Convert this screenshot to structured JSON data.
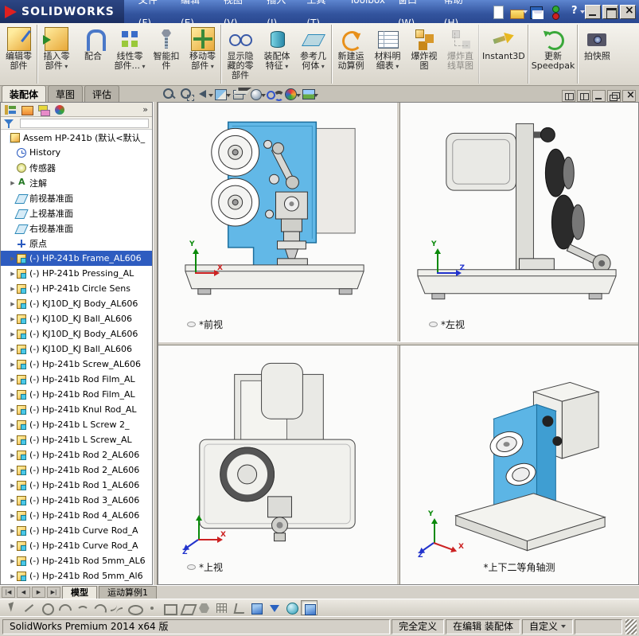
{
  "titlebar": {
    "logo_text": "SOLIDWORKS",
    "menus": [
      "文件(F)",
      "编辑(E)",
      "视图(V)",
      "插入(I)",
      "工具(T)",
      "Toolbox",
      "窗口(W)",
      "帮助(H)"
    ],
    "quick_icons": [
      {
        "name": "new-document-icon",
        "cls": "q-new",
        "dd": ""
      },
      {
        "name": "open-icon",
        "cls": "q-open",
        "dd": "has-dd"
      },
      {
        "name": "save-icon",
        "cls": "q-save",
        "dd": "has-dd"
      },
      {
        "name": "rebuild-icon",
        "cls": "q-rebuild",
        "dd": ""
      },
      {
        "name": "help-icon",
        "cls": "q-help",
        "dd": "has-dd"
      }
    ],
    "window_buttons": [
      "minimize",
      "maximize",
      "close"
    ]
  },
  "commandmanager": {
    "buttons": [
      {
        "label": "编辑零\n部件",
        "icon": "ic-editcomp",
        "name": "edit-component-button",
        "dd": "",
        "state": "",
        "grp": "grp-end"
      },
      {
        "label": "插入零\n部件",
        "icon": "ic-insertcomp",
        "name": "insert-components-button",
        "dd": "has-dd",
        "state": "",
        "grp": ""
      },
      {
        "label": "配合",
        "icon": "ic-mate",
        "name": "mate-button",
        "dd": "",
        "state": "",
        "grp": ""
      },
      {
        "label": "线性零\n部件...",
        "icon": "ic-pattern",
        "name": "linear-component-pattern-button",
        "dd": "has-dd",
        "state": "",
        "grp": ""
      },
      {
        "label": "智能扣\n件",
        "icon": "ic-fastener",
        "name": "smart-fasteners-button",
        "dd": "",
        "state": "",
        "grp": ""
      },
      {
        "label": "移动零\n部件",
        "icon": "ic-movecomp",
        "name": "move-component-button",
        "dd": "has-dd",
        "state": "",
        "grp": "grp-end"
      },
      {
        "label": "显示隐\n藏的零\n部件",
        "icon": "ic-showhidden",
        "name": "show-hidden-components-button",
        "dd": "",
        "state": "",
        "grp": ""
      },
      {
        "label": "装配体\n特征",
        "icon": "ic-asmfeat",
        "name": "assembly-features-button",
        "dd": "has-dd",
        "state": "",
        "grp": ""
      },
      {
        "label": "参考几\n何体",
        "icon": "ic-refgeo",
        "name": "reference-geometry-button",
        "dd": "has-dd",
        "state": "",
        "grp": "grp-end"
      },
      {
        "label": "新建运\n动算例",
        "icon": "ic-motion",
        "name": "new-motion-study-button",
        "dd": "",
        "state": "",
        "grp": ""
      },
      {
        "label": "材料明\n细表",
        "icon": "ic-bom",
        "name": "bill-of-materials-button",
        "dd": "has-dd",
        "state": "",
        "grp": ""
      },
      {
        "label": "爆炸视\n图",
        "icon": "ic-explode",
        "name": "exploded-view-button",
        "dd": "",
        "state": "",
        "grp": ""
      },
      {
        "label": "爆炸直\n线草图",
        "icon": "ic-explline",
        "name": "explode-line-sketch-button",
        "dd": "",
        "state": "disabled",
        "grp": "grp-end"
      },
      {
        "label": "Instant3D",
        "icon": "ic-instant3d",
        "name": "instant3d-button",
        "dd": "",
        "state": "",
        "grp": "grp-end"
      },
      {
        "label": "更新\nSpeedpak",
        "icon": "ic-speedpak",
        "name": "update-speedpak-button",
        "dd": "",
        "state": "",
        "grp": "grp-end"
      },
      {
        "label": "拍快照",
        "icon": "ic-snapshot",
        "name": "take-snapshot-button",
        "dd": "",
        "state": "",
        "grp": ""
      }
    ]
  },
  "ribbon_tabs": [
    {
      "label": "装配体",
      "cls": "active"
    },
    {
      "label": "草图",
      "cls": ""
    },
    {
      "label": "评估",
      "cls": ""
    }
  ],
  "view_toolbar": {
    "icons": [
      {
        "name": "zoom-fit-icon",
        "cls": "h-zoomfit",
        "dd": ""
      },
      {
        "name": "zoom-area-icon",
        "cls": "h-zoomarea",
        "dd": ""
      },
      {
        "name": "previous-view-icon",
        "cls": "h-prev",
        "dd": "has-dd"
      },
      {
        "name": "section-view-icon",
        "cls": "h-section",
        "dd": "has-dd"
      },
      {
        "name": "view-orientation-icon",
        "cls": "h-vieworient",
        "dd": "has-dd"
      },
      {
        "name": "display-style-icon",
        "cls": "h-display",
        "dd": "has-dd"
      },
      {
        "name": "hide-show-items-icon",
        "cls": "h-hideshow",
        "dd": "has-dd"
      },
      {
        "name": "edit-appearance-icon",
        "cls": "h-appearance",
        "dd": "has-dd"
      },
      {
        "name": "apply-scene-icon",
        "cls": "h-scene",
        "dd": "has-dd"
      }
    ],
    "window_icons": [
      "pane-layout",
      "pane-layout-2",
      "doc-minimize",
      "doc-restore",
      "doc-close"
    ]
  },
  "feature_tree": {
    "panel_tabs": [
      {
        "name": "featuremanager-tab-icon",
        "cls": "p-feat"
      },
      {
        "name": "propertymanager-tab-icon",
        "cls": "p-prop"
      },
      {
        "name": "configurationmanager-tab-icon",
        "cls": "p-config"
      },
      {
        "name": "displaymanager-tab-icon",
        "cls": "p-display"
      }
    ],
    "overflow": "»",
    "root": "Assem HP-241b (默认<默认_",
    "items": [
      {
        "t": "History",
        "icon": "i-history",
        "arrow": "",
        "cls": ""
      },
      {
        "t": "传感器",
        "icon": "i-sensor",
        "arrow": "",
        "cls": ""
      },
      {
        "t": "注解",
        "icon": "i-annot",
        "arrow": "▶",
        "cls": ""
      },
      {
        "t": "前视基准面",
        "icon": "i-plane",
        "arrow": "",
        "cls": ""
      },
      {
        "t": "上视基准面",
        "icon": "i-plane",
        "arrow": "",
        "cls": ""
      },
      {
        "t": "右视基准面",
        "icon": "i-plane",
        "arrow": "",
        "cls": ""
      },
      {
        "t": "原点",
        "icon": "i-origin",
        "arrow": "",
        "cls": ""
      },
      {
        "t": "(-) HP-241b Frame_AL606",
        "icon": "i-part",
        "arrow": "▶",
        "cls": "selected"
      },
      {
        "t": "(-) HP-241b Pressing_AL",
        "icon": "i-part",
        "arrow": "▶",
        "cls": ""
      },
      {
        "t": "(-) HP-241b Circle Sens",
        "icon": "i-part",
        "arrow": "▶",
        "cls": ""
      },
      {
        "t": "(-) KJ10D_KJ Body_AL606",
        "icon": "i-part",
        "arrow": "▶",
        "cls": ""
      },
      {
        "t": "(-) KJ10D_KJ Ball_AL606",
        "icon": "i-part",
        "arrow": "▶",
        "cls": ""
      },
      {
        "t": "(-) KJ10D_KJ Body_AL606",
        "icon": "i-part",
        "arrow": "▶",
        "cls": ""
      },
      {
        "t": "(-) KJ10D_KJ Ball_AL606",
        "icon": "i-part",
        "arrow": "▶",
        "cls": ""
      },
      {
        "t": "(-) Hp-241b Screw_AL606",
        "icon": "i-part",
        "arrow": "▶",
        "cls": ""
      },
      {
        "t": "(-) Hp-241b Rod Film_AL",
        "icon": "i-part",
        "arrow": "▶",
        "cls": ""
      },
      {
        "t": "(-) Hp-241b Rod Film_AL",
        "icon": "i-part",
        "arrow": "▶",
        "cls": ""
      },
      {
        "t": "(-) Hp-241b Knul Rod_AL",
        "icon": "i-part",
        "arrow": "▶",
        "cls": ""
      },
      {
        "t": "(-) Hp-241b L Screw 2_",
        "icon": "i-part",
        "arrow": "▶",
        "cls": ""
      },
      {
        "t": "(-) Hp-241b L Screw_AL",
        "icon": "i-part",
        "arrow": "▶",
        "cls": ""
      },
      {
        "t": "(-) Hp-241b Rod 2_AL606",
        "icon": "i-part",
        "arrow": "▶",
        "cls": ""
      },
      {
        "t": "(-) Hp-241b Rod 2_AL606",
        "icon": "i-part",
        "arrow": "▶",
        "cls": ""
      },
      {
        "t": "(-) Hp-241b Rod 1_AL606",
        "icon": "i-part",
        "arrow": "▶",
        "cls": ""
      },
      {
        "t": "(-) Hp-241b Rod 3_AL606",
        "icon": "i-part",
        "arrow": "▶",
        "cls": ""
      },
      {
        "t": "(-) Hp-241b Rod 4_AL606",
        "icon": "i-part",
        "arrow": "▶",
        "cls": ""
      },
      {
        "t": "(-) Hp-241b Curve Rod_A",
        "icon": "i-part",
        "arrow": "▶",
        "cls": ""
      },
      {
        "t": "(-) Hp-241b Curve Rod_A",
        "icon": "i-part",
        "arrow": "▶",
        "cls": ""
      },
      {
        "t": "(-) Hp-241b Rod 5mm_AL6",
        "icon": "i-part",
        "arrow": "▶",
        "cls": ""
      },
      {
        "t": "(-) Hp-241b Rod 5mm_Al6",
        "icon": "i-part",
        "arrow": "▶",
        "cls": ""
      }
    ]
  },
  "viewports": [
    {
      "label": "*前视",
      "axis_up": "Y",
      "axis_right": "X",
      "axis_diag": ""
    },
    {
      "label": "*左视",
      "axis_up": "Y",
      "axis_right": "Z",
      "axis_diag": ""
    },
    {
      "label": "*上视",
      "axis_up": "",
      "axis_right": "X",
      "axis_diag": "Z"
    },
    {
      "label": "*上下二等角轴测",
      "axis_up": "Y",
      "axis_right": "X",
      "axis_diag": "Z"
    }
  ],
  "bottom_tabs": {
    "nav": [
      {
        "name": "tab-first-button",
        "g": "|◀"
      },
      {
        "name": "tab-prev-button",
        "g": "◀"
      },
      {
        "name": "tab-next-button",
        "g": "▶"
      },
      {
        "name": "tab-last-button",
        "g": "▶|"
      }
    ],
    "tabs": [
      {
        "label": "模型",
        "cls": "active"
      },
      {
        "label": "运动算例1",
        "cls": ""
      }
    ]
  },
  "sketch_toolbar": {
    "icons": [
      {
        "name": "sketch-select-icon",
        "cls": "s-select",
        "pressed": ""
      },
      {
        "name": "sketch-line-icon",
        "cls": "s-line",
        "pressed": ""
      },
      {
        "name": "sketch-circle-icon",
        "cls": "s-circle",
        "pressed": ""
      },
      {
        "name": "sketch-centerpoint-arc-icon",
        "cls": "s-arc",
        "pressed": ""
      },
      {
        "name": "sketch-tangent-arc-icon",
        "cls": "s-arc2",
        "pressed": ""
      },
      {
        "name": "sketch-3point-arc-icon",
        "cls": "s-arc3",
        "pressed": ""
      },
      {
        "name": "sketch-spline-icon",
        "cls": "s-spline",
        "pressed": ""
      },
      {
        "name": "sketch-ellipse-icon",
        "cls": "s-ellipse",
        "pressed": ""
      },
      {
        "name": "sketch-point-icon",
        "cls": "s-point",
        "pressed": ""
      },
      {
        "name": "sketch-rectangle-icon",
        "cls": "s-rect",
        "pressed": ""
      },
      {
        "name": "sketch-parallelogram-icon",
        "cls": "s-para",
        "pressed": ""
      },
      {
        "name": "sketch-polygon-icon",
        "cls": "s-poly",
        "pressed": ""
      },
      {
        "name": "sketch-hatch-icon",
        "cls": "s-hatch",
        "pressed": ""
      },
      {
        "name": "sketch-angle-icon",
        "cls": "s-angle",
        "pressed": ""
      },
      {
        "name": "view-cube-icon",
        "cls": "c-cube",
        "pressed": ""
      },
      {
        "name": "view-arrow-icon",
        "cls": "c-arrow",
        "pressed": ""
      },
      {
        "name": "shaded-sphere-icon",
        "cls": "c-sphere",
        "pressed": ""
      },
      {
        "name": "view-mode-cube-icon",
        "cls": "c-cube",
        "pressed": "pressed"
      }
    ]
  },
  "statusbar": {
    "left": "SolidWorks Premium 2014 x64 版",
    "defined": "完全定义",
    "editing": "在编辑 装配体",
    "custom": "自定义"
  }
}
